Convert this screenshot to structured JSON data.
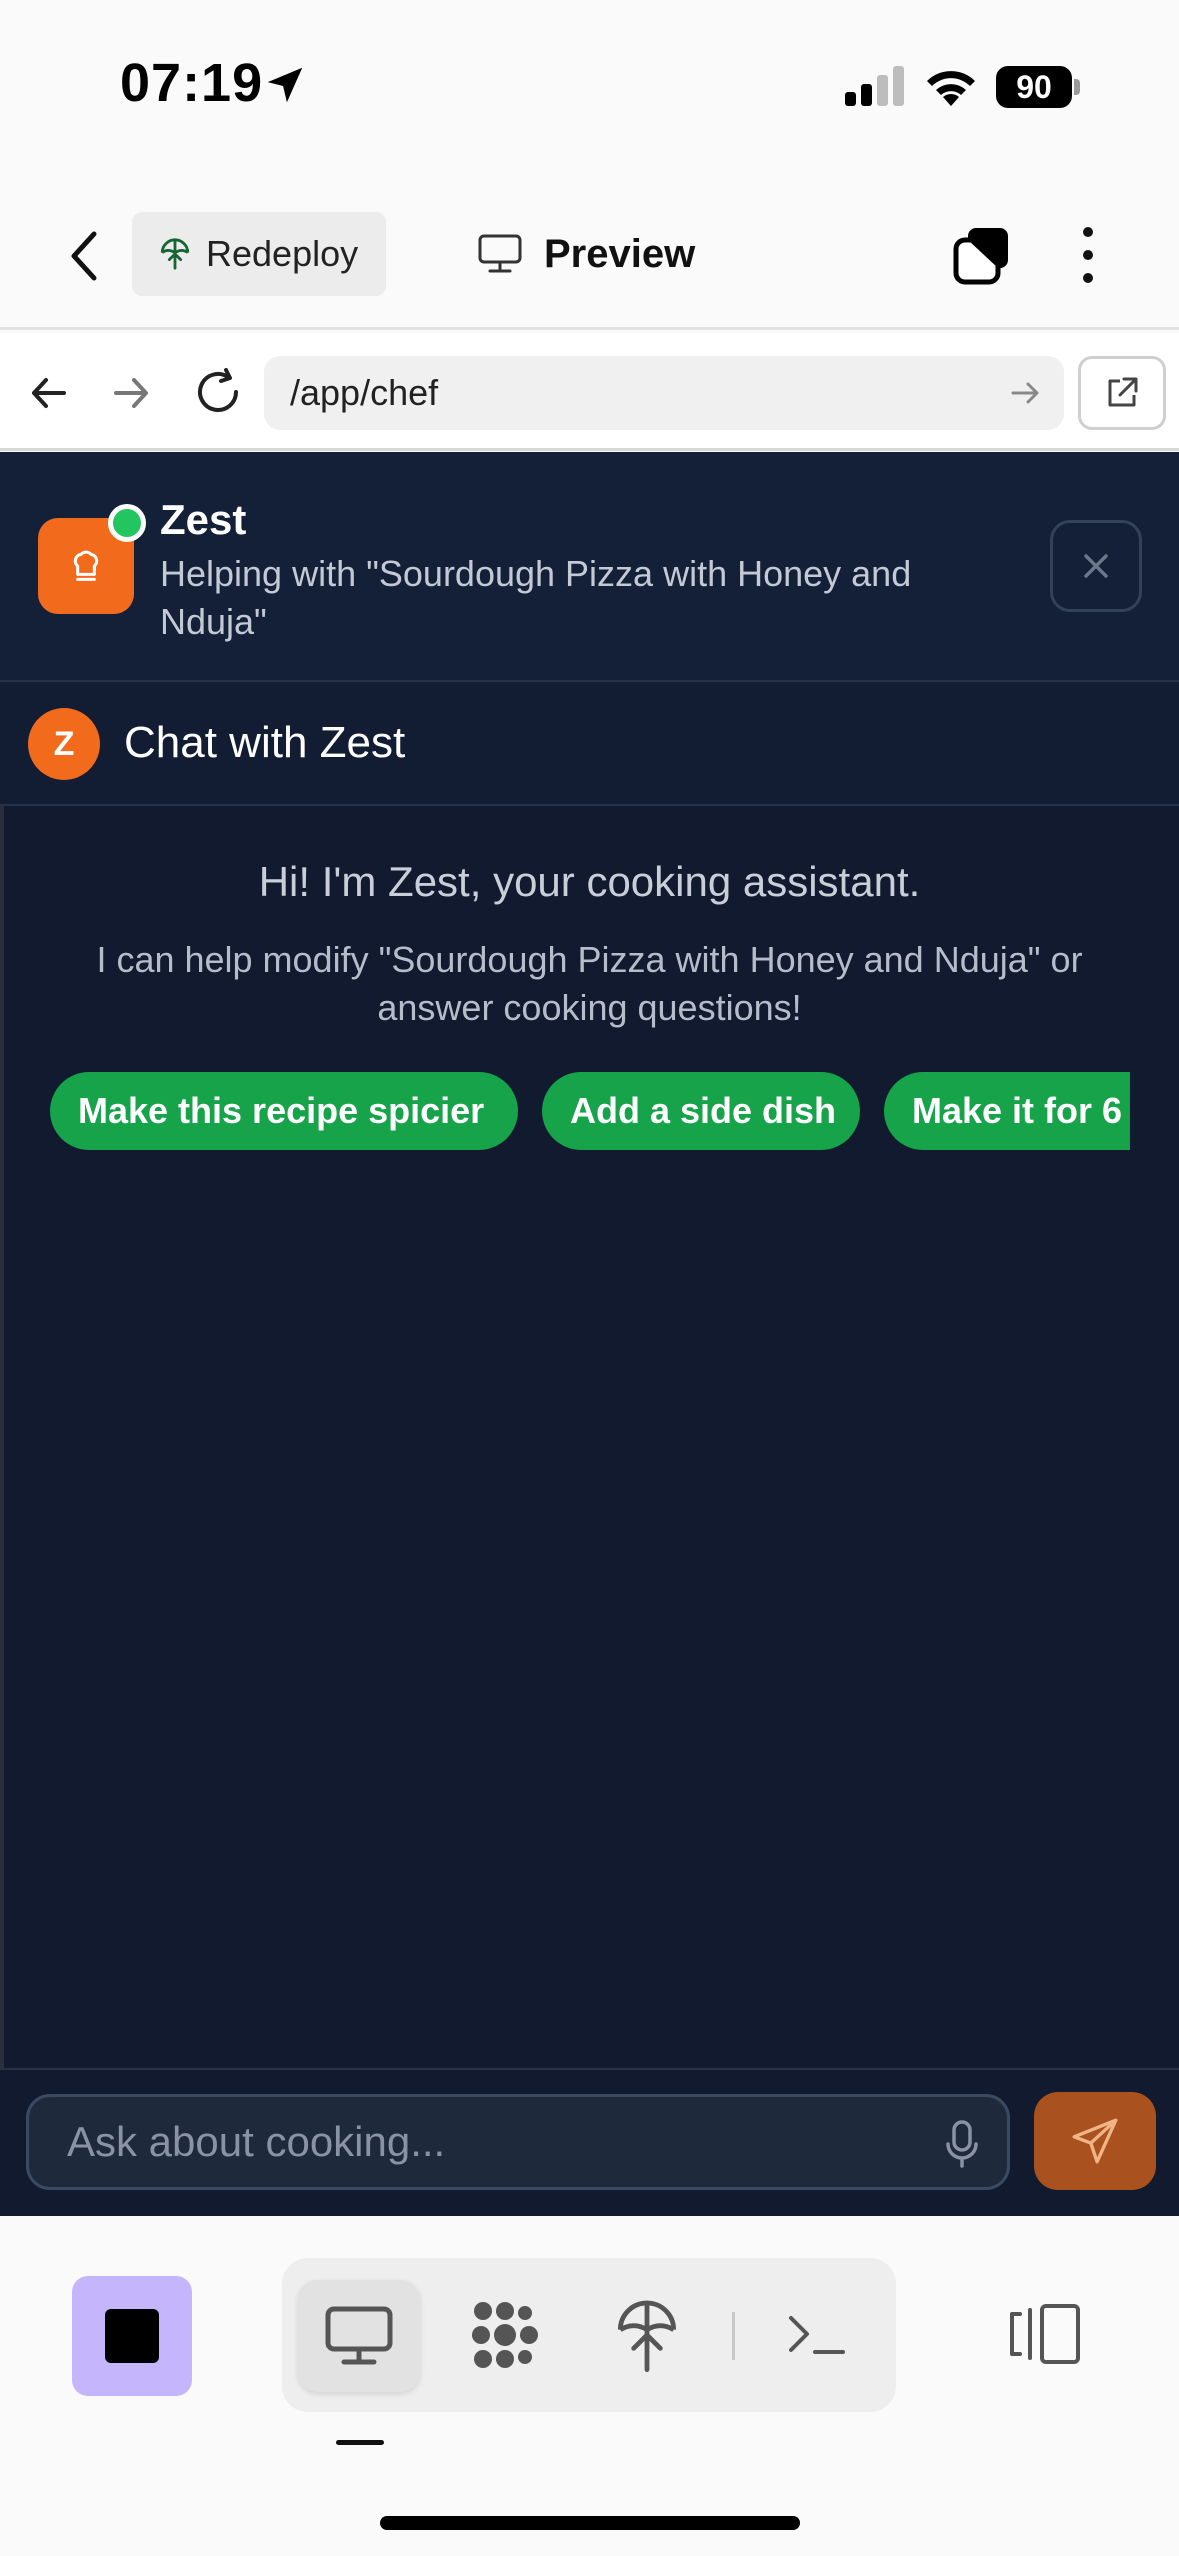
{
  "status_bar": {
    "time": "07:19",
    "battery": "90"
  },
  "app_bar": {
    "redeploy_label": "Redeploy",
    "preview_label": "Preview"
  },
  "browser": {
    "url": "/app/chef"
  },
  "assistant": {
    "name": "Zest",
    "subtitle": "Helping with \"Sourdough Pizza with Honey and Nduja\"",
    "avatar_letter": "Z",
    "chat_title": "Chat with Zest"
  },
  "welcome": {
    "title": "Hi! I'm Zest, your cooking assistant.",
    "text": "I can help modify \"Sourdough Pizza with Honey and Nduja\" or answer cooking questions!"
  },
  "suggestions": [
    "Make this recipe spicier",
    "Add a side dish",
    "Make it for 6"
  ],
  "chat_input": {
    "placeholder": "Ask about cooking..."
  },
  "colors": {
    "accent_orange": "#f26b1d",
    "chip_green": "#16a34a",
    "online_green": "#22c55e",
    "panel_bg": "#111a2e",
    "stop_purple": "#c4b5fd"
  },
  "icons": {
    "status": [
      "location-arrow-icon",
      "signal-icon",
      "wifi-icon",
      "battery-icon"
    ],
    "app_bar": [
      "back-chevron-icon",
      "deploy-icon",
      "monitor-icon",
      "tabs-icon",
      "more-vertical-icon"
    ],
    "browser": [
      "arrow-left-icon",
      "arrow-right-icon",
      "reload-icon",
      "external-link-icon"
    ],
    "chat": [
      "chef-hat-icon",
      "close-icon",
      "microphone-icon",
      "send-icon"
    ],
    "toolbar": [
      "stop-icon",
      "monitor-icon",
      "graph-icon",
      "deploy-icon",
      "terminal-icon",
      "split-view-icon"
    ]
  }
}
